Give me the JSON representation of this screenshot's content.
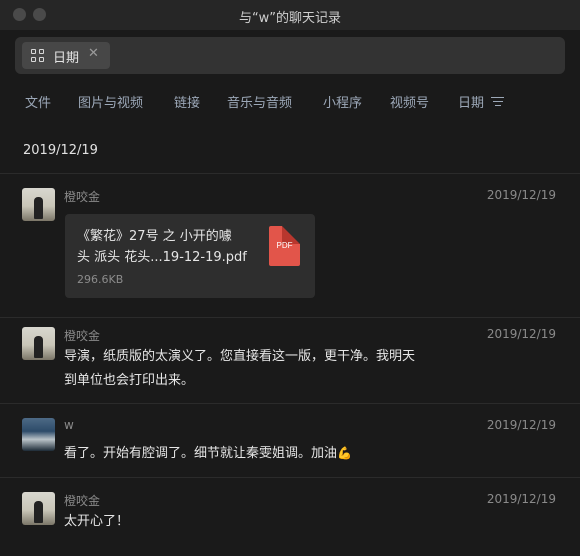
{
  "window": {
    "title": "与“w”的聊天记录"
  },
  "filter_chip": {
    "label": "日期",
    "close_glyph": "✕",
    "icon": "grid-icon"
  },
  "tabs": [
    "文件",
    "图片与视频",
    "链接",
    "音乐与音频",
    "小程序",
    "视频号",
    "日期"
  ],
  "date_header": "2019/12/19",
  "messages": [
    {
      "sender": "橙咬金",
      "time": "2019/12/19",
      "avatar": "person-avatar",
      "file": {
        "name_line1": "《繁花》27号 之 小开的噱",
        "name_line2": "头 派头 花头...19-12-19.pdf",
        "size": "296.6KB",
        "badge": "PDF"
      }
    },
    {
      "sender": "橙咬金",
      "time": "2019/12/19",
      "avatar": "person-avatar",
      "line1": "导演，纸质版的太演义了。您直接看这一版，更干净。我明天",
      "line2": "到单位也会打印出来。"
    },
    {
      "sender": "w",
      "time": "2019/12/19",
      "avatar": "sea-avatar",
      "line1": "看了。开始有腔调了。细节就让秦雯姐调。加油",
      "emoji": "💪"
    },
    {
      "sender": "橙咬金",
      "time": "2019/12/19",
      "avatar": "person-avatar",
      "line1": "太开心了！"
    }
  ]
}
